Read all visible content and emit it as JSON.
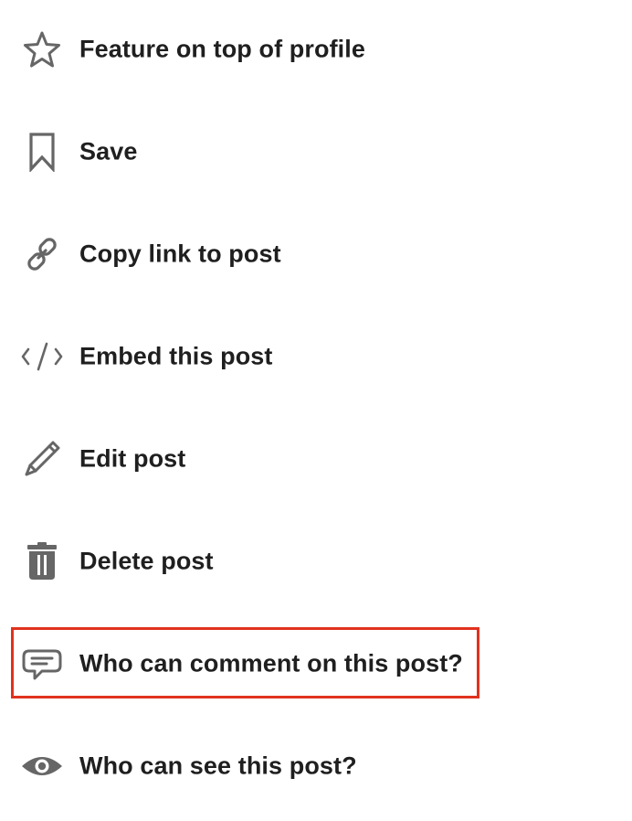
{
  "colors": {
    "text": "#1f1f1f",
    "icon": "#666666",
    "highlight": "#e0321e"
  },
  "menu": {
    "items": [
      {
        "id": "feature",
        "icon": "star-icon",
        "label": "Feature on top of profile"
      },
      {
        "id": "save",
        "icon": "bookmark-icon",
        "label": "Save"
      },
      {
        "id": "copy-link",
        "icon": "link-icon",
        "label": "Copy link to post"
      },
      {
        "id": "embed",
        "icon": "code-icon",
        "label": "Embed this post"
      },
      {
        "id": "edit",
        "icon": "pencil-icon",
        "label": "Edit post"
      },
      {
        "id": "delete",
        "icon": "trash-icon",
        "label": "Delete post"
      },
      {
        "id": "who-comment",
        "icon": "comment-icon",
        "label": "Who can comment on this post?",
        "highlighted": true
      },
      {
        "id": "who-see",
        "icon": "eye-icon",
        "label": "Who can see this post?"
      }
    ]
  }
}
